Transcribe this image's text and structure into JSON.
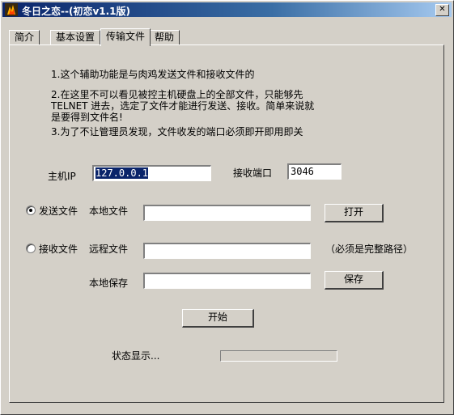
{
  "window": {
    "title": "冬日之恋--(初恋v1.1版)",
    "close_glyph": "✕"
  },
  "tabs": [
    {
      "label": "简介"
    },
    {
      "label": "基本设置"
    },
    {
      "label": "传输文件",
      "active": true
    },
    {
      "label": "帮助"
    }
  ],
  "info": {
    "line1": "1.这个辅助功能是与肉鸡发送文件和接收文件的",
    "line2a": "2.在这里不可以看见被控主机硬盘上的全部文件，只能够先",
    "line2b": "TELNET 进去，选定了文件才能进行发送、接收。简单来说就",
    "line2c": "是要得到文件名!",
    "line3": "3.为了不让管理员发现，文件收发的端口必须即开即用即关"
  },
  "host": {
    "label": "主机IP",
    "value": "127.0.0.1"
  },
  "port": {
    "label": "接收端口",
    "value": "3046"
  },
  "send": {
    "radio_label": "发送文件",
    "checked": true,
    "file_label": "本地文件",
    "file_value": "",
    "open_button": "打开"
  },
  "receive": {
    "radio_label": "接收文件",
    "checked": false,
    "remote_label": "远程文件",
    "remote_value": "",
    "hint": "（必须是完整路径）",
    "save_label": "本地保存",
    "save_value": "",
    "save_button": "保存"
  },
  "start_button": "开始",
  "status": {
    "label": "状态显示...",
    "progress": 0
  },
  "icons": {
    "app": "app-flame-icon",
    "close": "close-icon"
  }
}
